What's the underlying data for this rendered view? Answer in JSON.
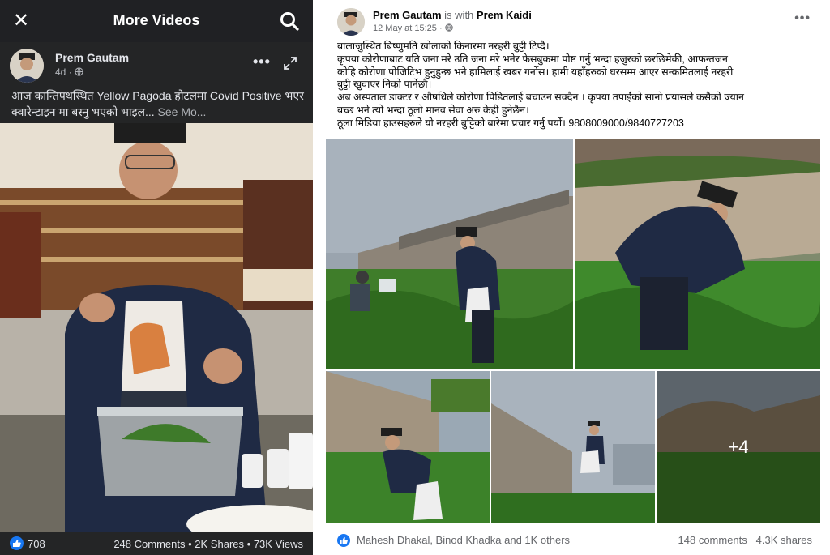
{
  "left": {
    "topbar": {
      "title": "More Videos",
      "close_icon": "close-icon",
      "search_icon": "search-icon"
    },
    "post": {
      "author": "Prem Gautam",
      "time": "4d",
      "audience_icon": "globe-icon",
      "more_label": "•••",
      "text": "आज कान्तिपथस्थित Yellow Pagoda होटलमा Covid Positive भएर क्वारेन्टाइन मा बस्नु भएको भाइल...",
      "see_more": "See Mo..."
    },
    "footer": {
      "likes": "708",
      "comments": "248 Comments",
      "shares": "2K Shares",
      "views": "73K Views",
      "separator": "•"
    }
  },
  "right": {
    "header": {
      "author": "Prem Gautam",
      "with_word": "is with",
      "tagged": "Prem Kaidi",
      "date": "12 May at 15:25",
      "more_label": "•••"
    },
    "text_lines": [
      "बालाजुस्थित बिष्णुमति खोलाको किनारमा नरहरी बुट्टी टिप्दै।",
      "कृपया कोरोणाबाट यति जना मरे उति जना मरे भनेर फेसबुकमा पोष्ट गर्नु भन्दा हजुरको छरछिमेकी, आफन्तजन",
      "कोहि कोरोणा पोजिटिभ हुनुहुन्छ भने हामिलाई खबर गर्नोस। हामी यहाँहरुको घरसम्म आएर सन्क्रमितलाई नरहरी",
      "बुट्टी खुवाएर निको पार्नेछौ।",
      "अब अस्पताल डाक्टर र औषधिले कोरोणा पिडितलाई बचाउन सक्दैन । कृपया तपाईंको सानो प्रयासले कसैको ज्यान",
      "बच्छ भने त्यो भन्दा ठूलो मानव सेवा अरु केही हुनेछैन।",
      "ठूला मिडिया हाउसहरुले यो नरहरी बुट्टिको बारेमा प्रचार गर्नु पर्यो। 9808009000/9840727203"
    ],
    "photos": {
      "more_count": "+4"
    },
    "footer": {
      "reactors": "Mahesh Dhakal, Binod Khadka and 1K others",
      "comments": "148 comments",
      "shares": "4.3K shares"
    }
  }
}
